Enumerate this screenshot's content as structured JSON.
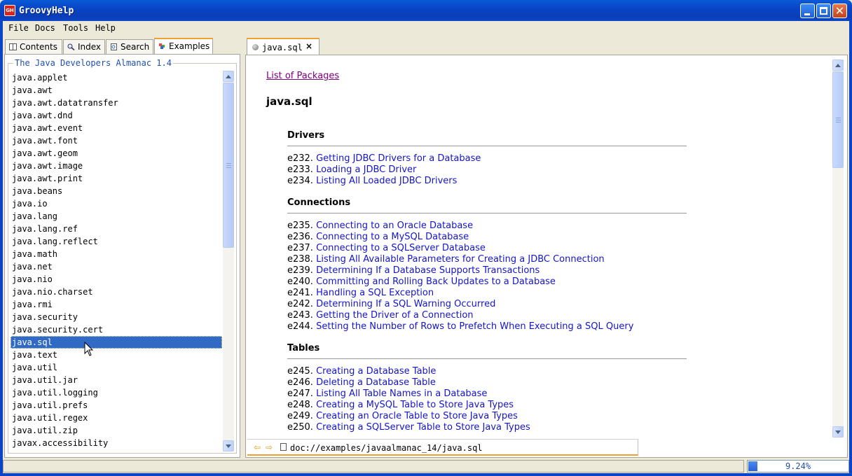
{
  "window": {
    "title": "GroovyHelp",
    "icon_text": "GH"
  },
  "menu": [
    "File",
    "Docs",
    "Tools",
    "Help"
  ],
  "left_tabs": [
    {
      "label": "Contents",
      "icon": "book-icon"
    },
    {
      "label": "Index",
      "icon": "magnifier-icon"
    },
    {
      "label": "Search",
      "icon": "search-doc-icon"
    },
    {
      "label": "Examples",
      "icon": "examples-icon",
      "active": true
    }
  ],
  "almanac": {
    "title": "The Java Developers Almanac 1.4",
    "packages": [
      "java.applet",
      "java.awt",
      "java.awt.datatransfer",
      "java.awt.dnd",
      "java.awt.event",
      "java.awt.font",
      "java.awt.geom",
      "java.awt.image",
      "java.awt.print",
      "java.beans",
      "java.io",
      "java.lang",
      "java.lang.ref",
      "java.lang.reflect",
      "java.math",
      "java.net",
      "java.nio",
      "java.nio.charset",
      "java.rmi",
      "java.security",
      "java.security.cert",
      "java.sql",
      "java.text",
      "java.util",
      "java.util.jar",
      "java.util.logging",
      "java.util.prefs",
      "java.util.regex",
      "java.util.zip",
      "javax.accessibility"
    ],
    "selected": "java.sql"
  },
  "doc_tab": {
    "label": "java.sql",
    "close": "×"
  },
  "content": {
    "list_link": "List of Packages",
    "package_title": "java.sql",
    "sections": [
      {
        "title": "Drivers",
        "items": [
          {
            "code": "e232.",
            "text": "Getting JDBC Drivers for a Database"
          },
          {
            "code": "e233.",
            "text": "Loading a JDBC Driver"
          },
          {
            "code": "e234.",
            "text": "Listing All Loaded JDBC Drivers"
          }
        ]
      },
      {
        "title": "Connections",
        "items": [
          {
            "code": "e235.",
            "text": "Connecting to an Oracle Database"
          },
          {
            "code": "e236.",
            "text": "Connecting to a MySQL Database"
          },
          {
            "code": "e237.",
            "text": "Connecting to a SQLServer Database"
          },
          {
            "code": "e238.",
            "text": "Listing All Available Parameters for Creating a JDBC Connection"
          },
          {
            "code": "e239.",
            "text": "Determining If a Database Supports Transactions"
          },
          {
            "code": "e240.",
            "text": "Committing and Rolling Back Updates to a Database"
          },
          {
            "code": "e241.",
            "text": "Handling a SQL Exception"
          },
          {
            "code": "e242.",
            "text": "Determining If a SQL Warning Occurred"
          },
          {
            "code": "e243.",
            "text": "Getting the Driver of a Connection"
          },
          {
            "code": "e244.",
            "text": "Setting the Number of Rows to Prefetch When Executing a SQL Query"
          }
        ]
      },
      {
        "title": "Tables",
        "items": [
          {
            "code": "e245.",
            "text": "Creating a Database Table"
          },
          {
            "code": "e246.",
            "text": "Deleting a Database Table"
          },
          {
            "code": "e247.",
            "text": "Listing All Table Names in a Database"
          },
          {
            "code": "e248.",
            "text": "Creating a MySQL Table to Store Java Types"
          },
          {
            "code": "e249.",
            "text": "Creating an Oracle Table to Store Java Types"
          },
          {
            "code": "e250.",
            "text": "Creating a SQLServer Table to Store Java Types"
          }
        ]
      }
    ]
  },
  "address": "doc://examples/javaalmanac_14/java.sql",
  "status": {
    "progress_text": "9.24%",
    "progress_fraction": 0.0924
  },
  "colors": {
    "accent": "#f0a030",
    "selection": "#316ac5",
    "link": "#1515c8",
    "visited_link": "#800080"
  }
}
